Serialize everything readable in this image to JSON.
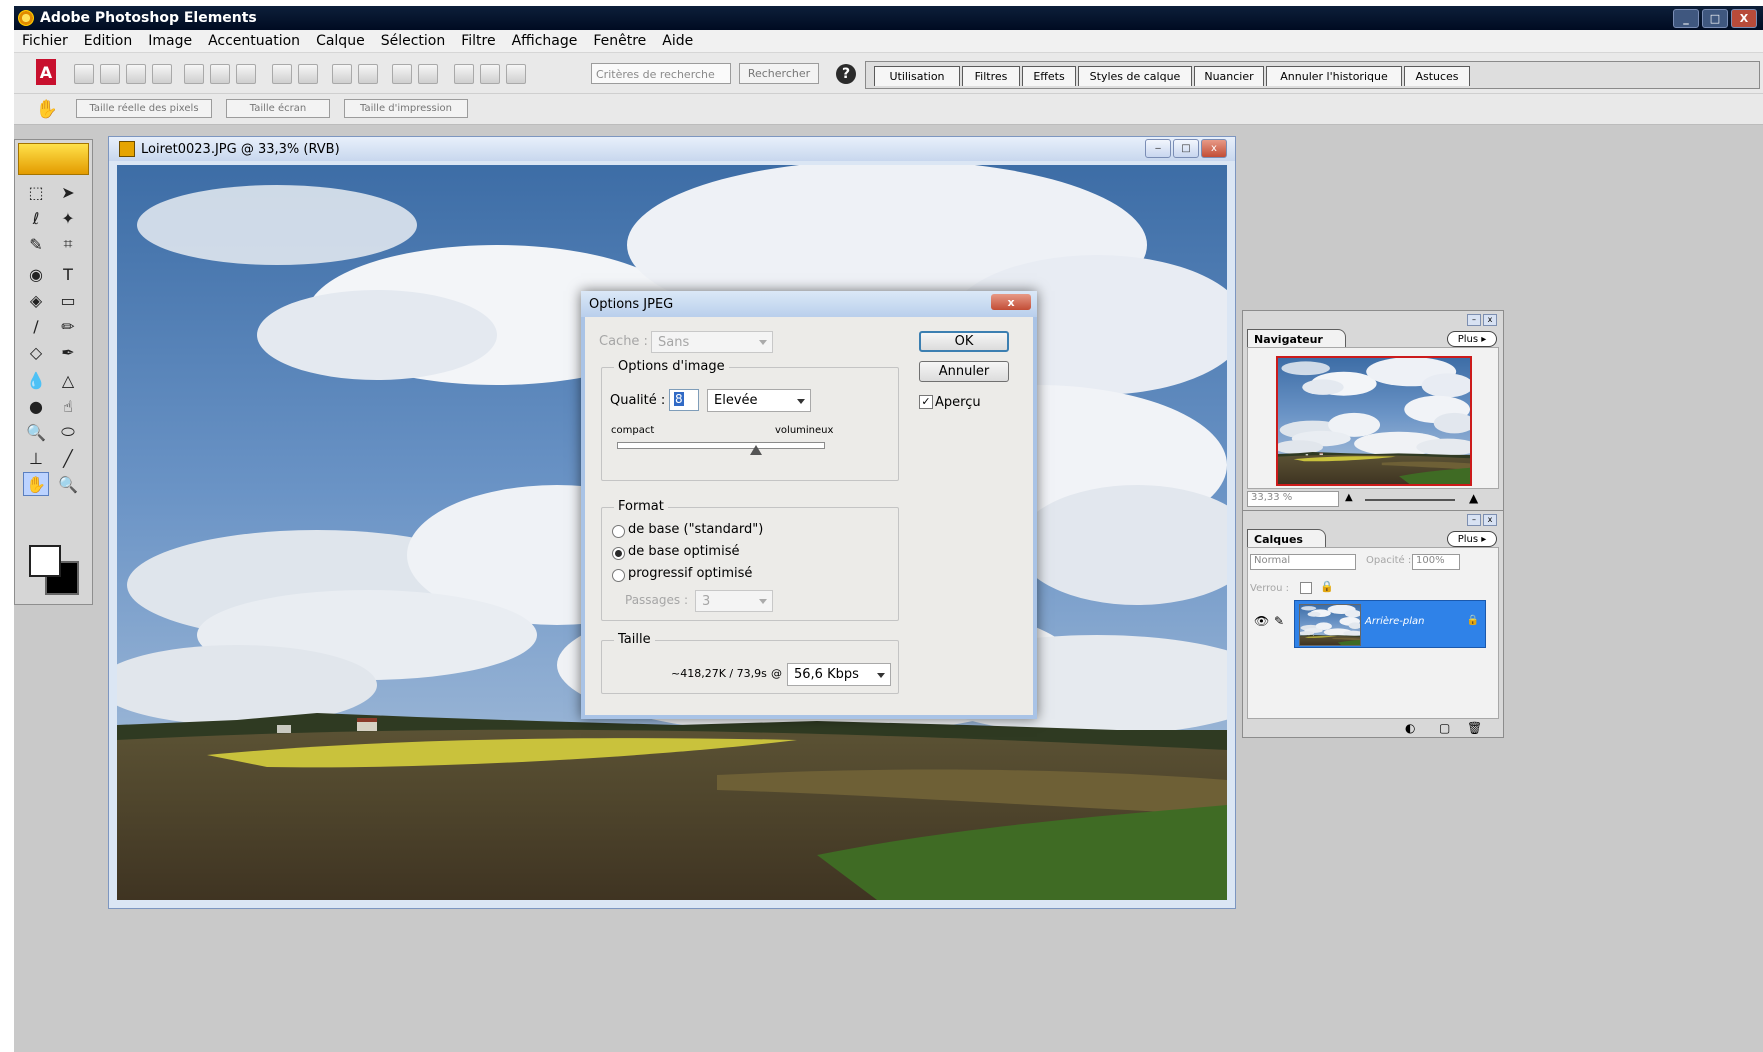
{
  "app": {
    "title": "Adobe Photoshop Elements",
    "window_controls": [
      "_",
      "□",
      "X"
    ]
  },
  "menu": [
    "Fichier",
    "Edition",
    "Image",
    "Accentuation",
    "Calque",
    "Sélection",
    "Filtre",
    "Affichage",
    "Fenêtre",
    "Aide"
  ],
  "toolbar": {
    "search_placeholder": "Critères de recherche",
    "search_button": "Rechercher",
    "help_icon": "?",
    "palette_tabs": [
      "Utilisation",
      "Filtres",
      "Effets",
      "Styles de calque",
      "Nuancier",
      "Annuler l'historique",
      "Astuces"
    ]
  },
  "options_bar": {
    "buttons": [
      "Taille réelle des pixels",
      "Taille écran",
      "Taille d'impression"
    ]
  },
  "document": {
    "title": "Loiret0023.JPG @ 33,3% (RVB)"
  },
  "dialog": {
    "title": "Options JPEG",
    "close": "x",
    "cache_label": "Cache :",
    "cache_value": "Sans",
    "image_options_title": "Options d'image",
    "quality_label": "Qualité :",
    "quality_value": "8",
    "quality_preset": "Elevée",
    "slider_min_label": "compact",
    "slider_max_label": "volumineux",
    "quality_slider_fraction": 0.67,
    "format_title": "Format",
    "format_options": [
      "de base (\"standard\")",
      "de base optimisé",
      "progressif optimisé"
    ],
    "format_selected": 1,
    "passes_label": "Passages :",
    "passes_value": "3",
    "size_title": "Taille",
    "size_text": "~418,27K / 73,9s",
    "at_symbol": "@",
    "speed_value": "56,6 Kbps",
    "ok": "OK",
    "cancel": "Annuler",
    "preview_label": "Aperçu",
    "preview_checked": true
  },
  "navigator": {
    "tab": "Navigateur",
    "more": "Plus ▸",
    "zoom": "33,33 %"
  },
  "layers": {
    "tab": "Calques",
    "more": "Plus ▸",
    "blend_mode": "Normal",
    "opacity_label": "Opacité :",
    "opacity_value": "100%",
    "lock_label": "Verrou :",
    "layer_name": "Arrière-plan"
  },
  "colors": {
    "accent": "#2f82e8",
    "titlebar": "#0d1f3a",
    "dialog_border": "#a9c3e6"
  }
}
